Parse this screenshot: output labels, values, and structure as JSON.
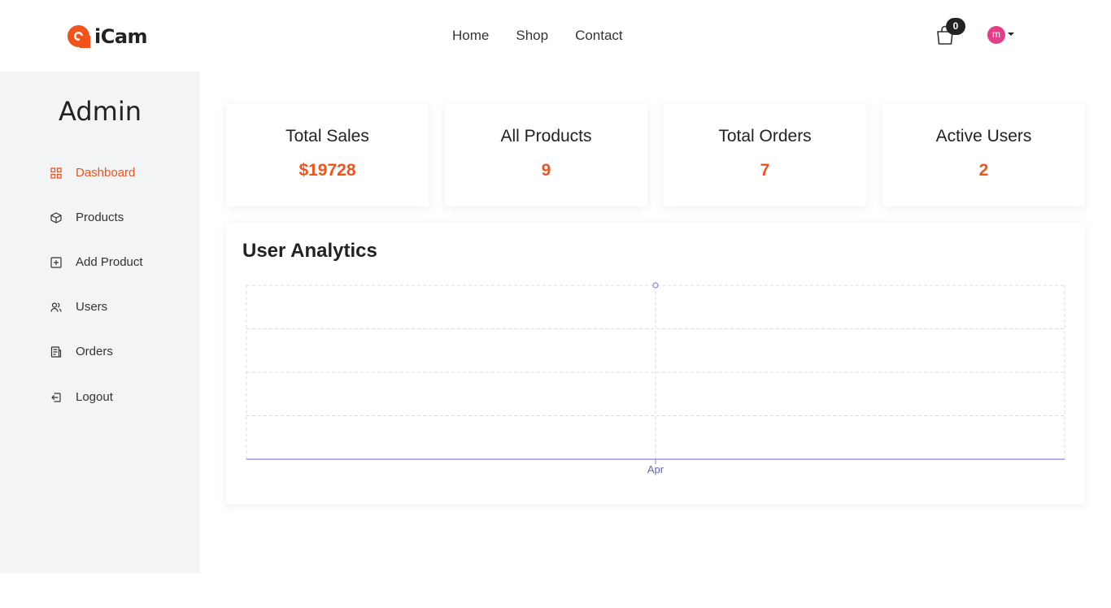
{
  "header": {
    "logo_text": "iCam",
    "nav": [
      "Home",
      "Shop",
      "Contact"
    ],
    "cart_count": "0",
    "avatar_initial": "m"
  },
  "sidebar": {
    "title": "Admin",
    "items": [
      {
        "label": "Dashboard",
        "icon": "grid-icon",
        "active": true
      },
      {
        "label": "Products",
        "icon": "box-icon"
      },
      {
        "label": "Add Product",
        "icon": "plus-square-icon"
      },
      {
        "label": "Users",
        "icon": "users-icon"
      },
      {
        "label": "Orders",
        "icon": "receipt-icon"
      },
      {
        "label": "Logout",
        "icon": "logout-icon"
      }
    ]
  },
  "stats": [
    {
      "title": "Total Sales",
      "value": "$19728"
    },
    {
      "title": "All Products",
      "value": "9"
    },
    {
      "title": "Total Orders",
      "value": "7"
    },
    {
      "title": "Active Users",
      "value": "2"
    }
  ],
  "analytics": {
    "title": "User Analytics"
  },
  "chart_data": {
    "type": "line",
    "x": [
      "Apr"
    ],
    "series": [
      {
        "values": [
          4
        ]
      }
    ],
    "ylim": [
      0,
      4
    ],
    "grid": true,
    "colors": {
      "line": "#8884d8",
      "accent": "#f0531c"
    }
  }
}
